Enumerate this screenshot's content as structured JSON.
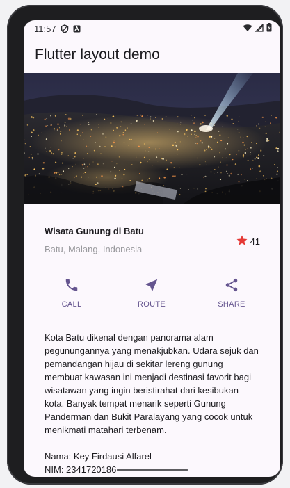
{
  "status_bar": {
    "time": "11:57",
    "icons": [
      "shield-icon",
      "app-notification-icon",
      "wifi-icon",
      "cellular-icon",
      "battery-icon"
    ]
  },
  "app_bar": {
    "title": "Flutter layout demo"
  },
  "hero_image": {
    "icon": "night-city-photo"
  },
  "place": {
    "title": "Wisata Gunung di Batu",
    "location": "Batu, Malang, Indonesia",
    "rating_count": "41",
    "star_color": "#e53935"
  },
  "actions": [
    {
      "label": "CALL",
      "icon": "call-icon"
    },
    {
      "label": "ROUTE",
      "icon": "near-me-icon"
    },
    {
      "label": "SHARE",
      "icon": "share-icon"
    }
  ],
  "accent_color": "#65558f",
  "description": "Kota Batu dikenal dengan panorama alam pegunungannya yang menakjubkan. Udara sejuk dan pemandangan hijau di sekitar lereng gunung membuat kawasan ini menjadi destinasi favorit bagi wisatawan yang ingin beristirahat dari kesibukan kota. Banyak tempat menarik seperti Gunung Panderman dan Bukit Paralayang yang cocok untuk menikmati matahari terbenam.",
  "author": {
    "name": "Nama: Key Firdausi Alfarel",
    "nim": "NIM: 2341720186"
  }
}
